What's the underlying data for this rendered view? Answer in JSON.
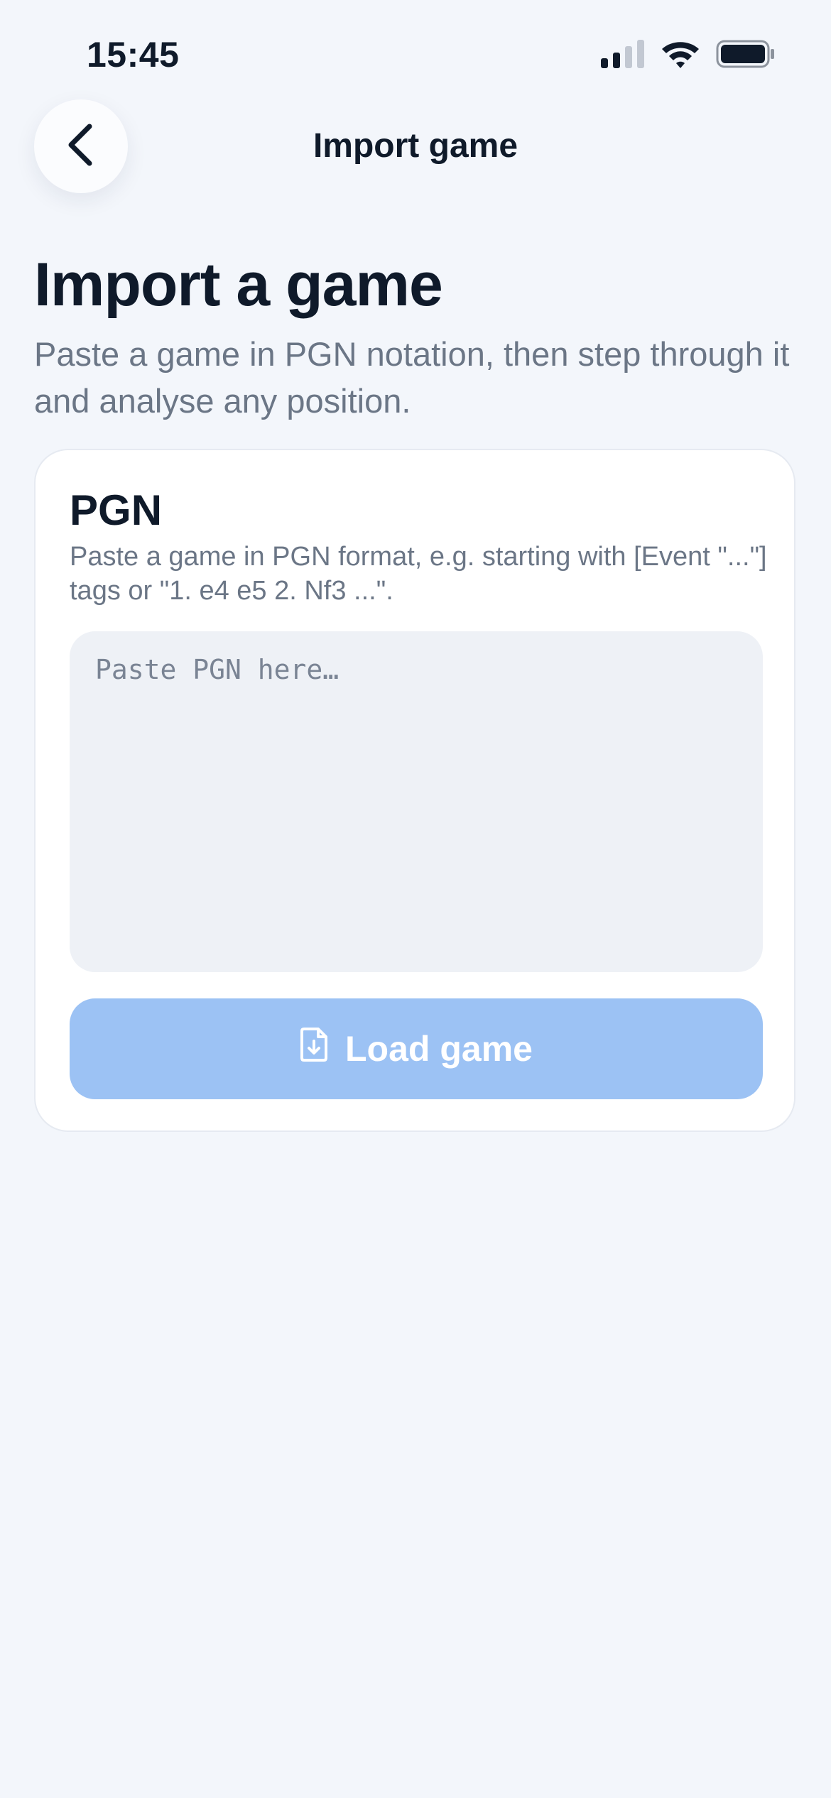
{
  "status_bar": {
    "time": "15:45",
    "icons": [
      "cellular-signal-icon",
      "wifi-icon",
      "battery-icon"
    ]
  },
  "nav": {
    "back_icon": "chevron-left-icon",
    "title": "Import game"
  },
  "page": {
    "title": "Import a game",
    "subtitle": "Paste a game in PGN notation, then step through it and analyse any position."
  },
  "card": {
    "title": "PGN",
    "help": "Paste a game in PGN format, e.g. starting with [Event \"...\"] tags or \"1. e4 e5 2. Nf3 ...\".",
    "input": {
      "value": "",
      "placeholder": "Paste PGN here…"
    },
    "load_button": {
      "icon": "file-download-icon",
      "label": "Load game"
    }
  },
  "colors": {
    "background": "#f3f6fb",
    "card": "#ffffff",
    "input_bg": "#eef1f6",
    "button_disabled": "#9cc2f4",
    "text_primary": "#0f1a2a",
    "text_secondary": "#6b7686"
  }
}
